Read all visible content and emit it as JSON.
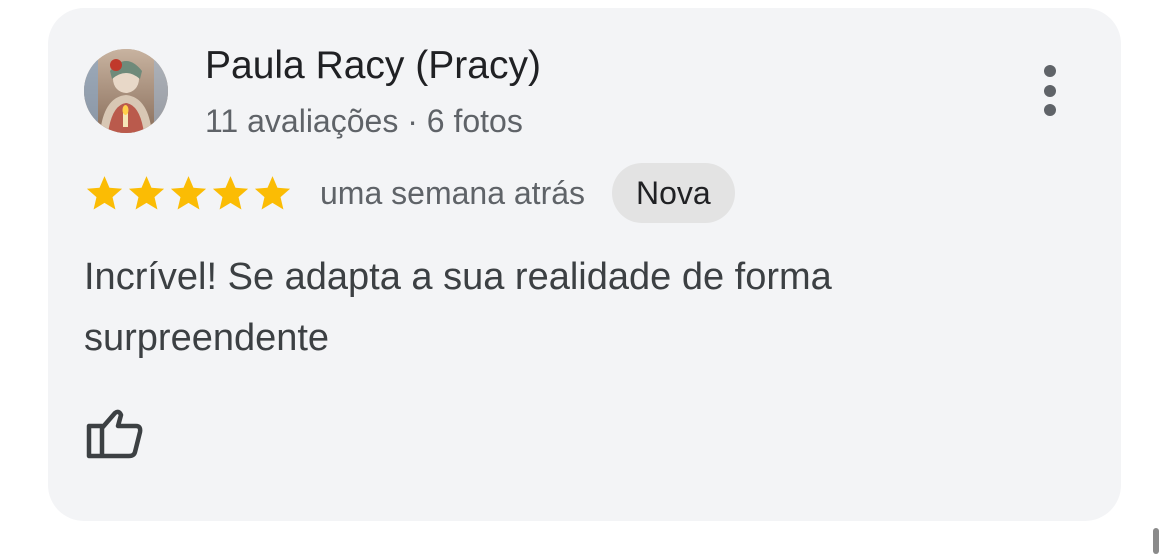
{
  "review": {
    "author_name": "Paula Racy (Pracy)",
    "author_meta": "11 avaliações · 6 fotos",
    "rating": 5,
    "rating_max": 5,
    "time": "uma semana atrás",
    "badge": "Nova",
    "text": "Incrível! Se adapta a sua realidade de forma surpreendente"
  },
  "icons": {
    "more": "more-vert-icon",
    "like": "thumb-up-icon",
    "star": "star-icon"
  },
  "colors": {
    "card_background": "#f3f4f6",
    "star": "#fbbc04",
    "badge_background": "#e3e3e3",
    "primary_text": "#202124",
    "secondary_text": "#5f6368"
  }
}
